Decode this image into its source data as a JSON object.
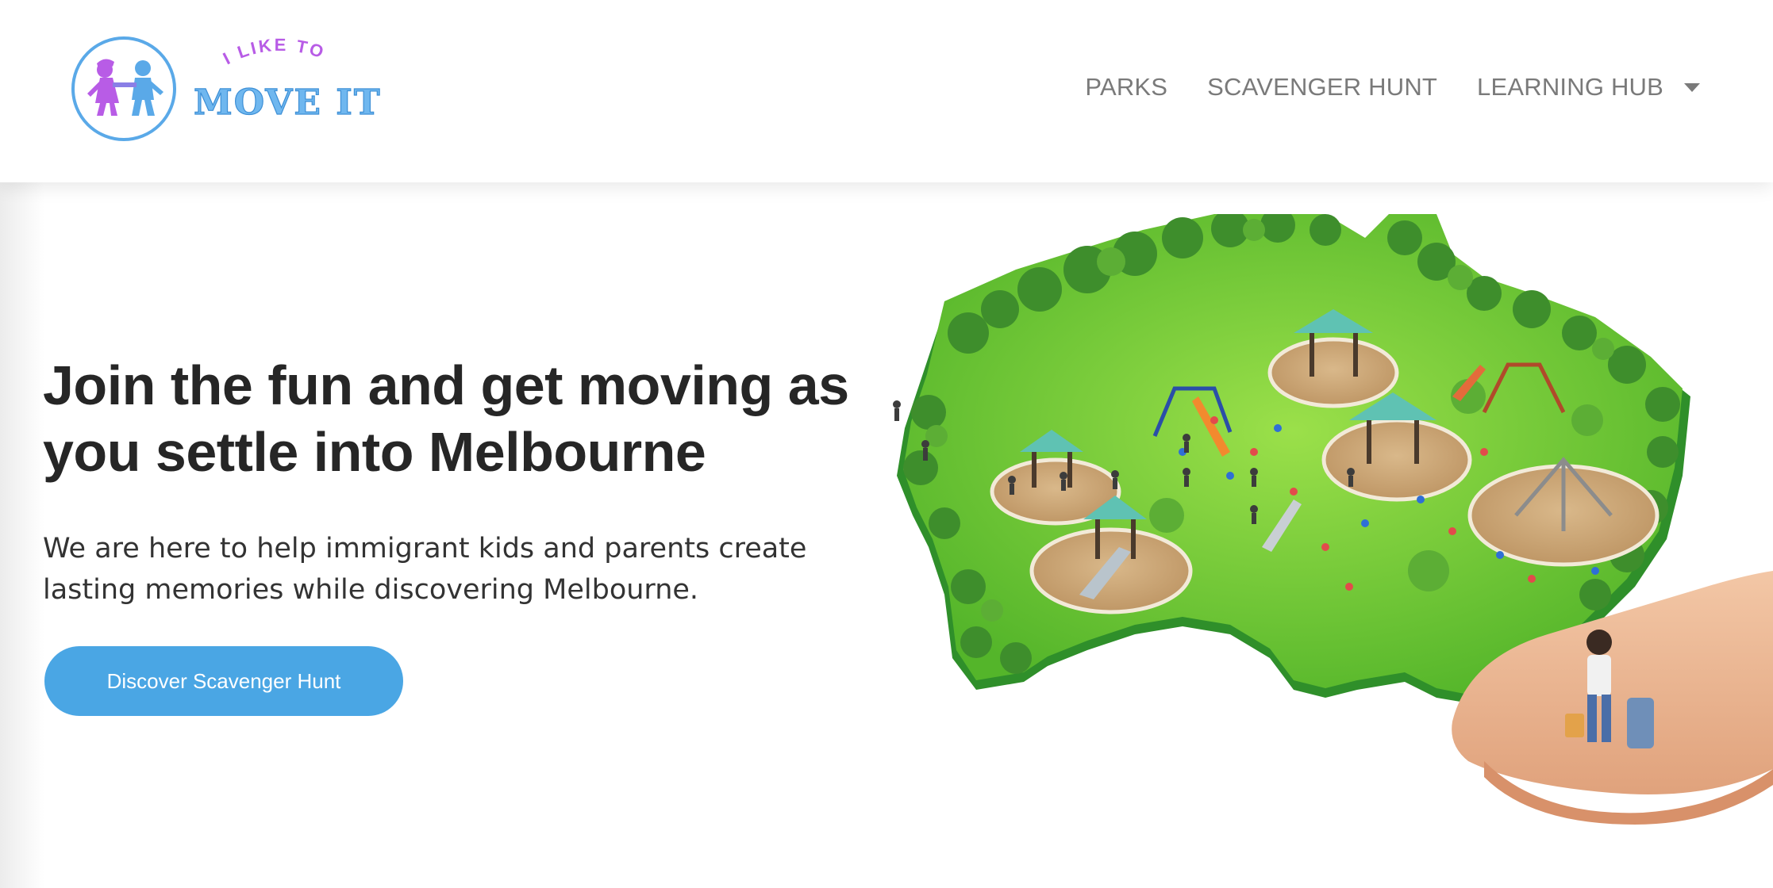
{
  "logo": {
    "top_text": "I LIKE TO",
    "main_text": "MOVE IT",
    "alt": "I Like To Move It logo"
  },
  "nav": {
    "items": [
      {
        "label": "PARKS"
      },
      {
        "label": "SCAVENGER HUNT"
      },
      {
        "label": "LEARNING HUB",
        "has_dropdown": true
      }
    ]
  },
  "hero": {
    "title": "Join the fun and get moving as you settle into Melbourne",
    "subtitle": "We are here to help immigrant kids and parents create lasting memories while discovering Melbourne.",
    "cta_label": "Discover Scavenger Hunt"
  },
  "colors": {
    "accent": "#4aa6e4",
    "logo_purple": "#b85ce6",
    "logo_blue": "#5aa9e8",
    "nav_text": "#7a7a7a",
    "heading": "#262626"
  },
  "icons": {
    "logo_figures": "two-kids-holding-hands-icon",
    "nav_dropdown": "caret-down-icon"
  }
}
